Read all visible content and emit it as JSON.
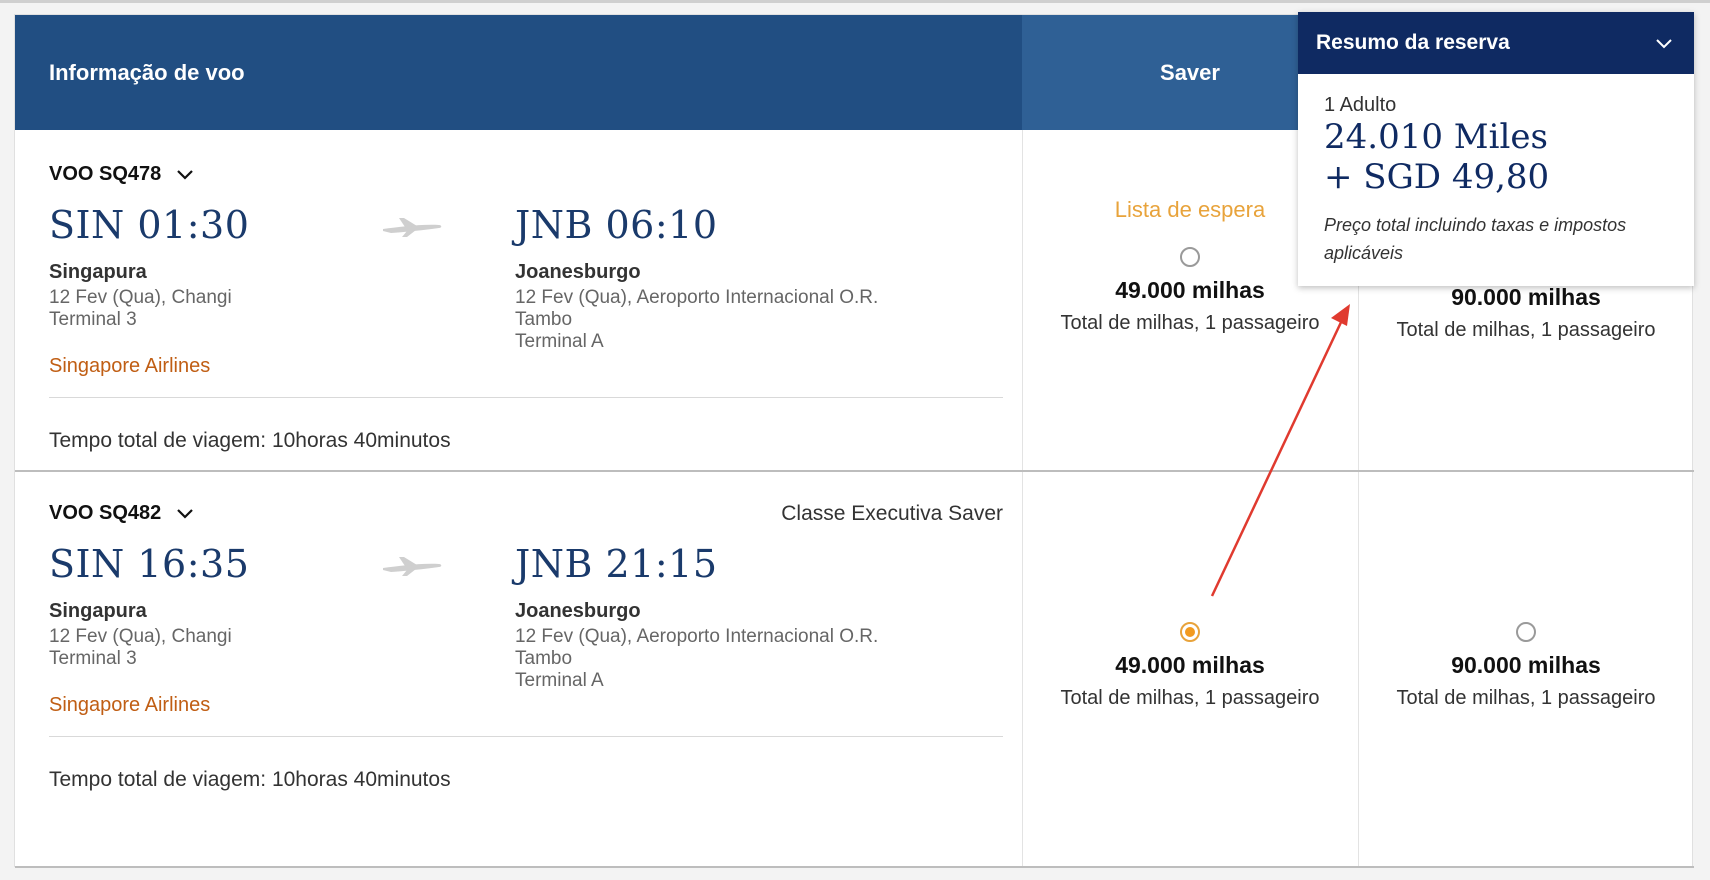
{
  "header": {
    "info_label": "Informação de voo",
    "saver_label": "Saver"
  },
  "summary": {
    "title": "Resumo da reserva",
    "passengers": "1 Adulto",
    "miles": "24.010 Miles",
    "cash": "+ SGD 49,80",
    "note": "Preço total incluindo taxas e impostos aplicáveis"
  },
  "flights": [
    {
      "flight_no": "VOO SQ478",
      "cabin": "",
      "dep_time": "SIN 01:30",
      "dep_city": "Singapura",
      "dep_detail1": "12 Fev (Qua), Changi",
      "dep_detail2": "Terminal 3",
      "arr_time": "JNB 06:10",
      "arr_city": "Joanesburgo",
      "arr_detail1": "12 Fev (Qua), Aeroporto Internacional O.R.",
      "arr_detail2": "Tambo",
      "arr_detail3": "Terminal A",
      "airline": "Singapore Airlines",
      "total_time": "Tempo total de viagem: 10horas 40minutos",
      "fares": [
        {
          "status": "Lista de espera",
          "miles": "49.000 milhas",
          "sub": "Total de milhas, 1 passageiro",
          "selected": false
        },
        {
          "status": "",
          "miles": "90.000 milhas",
          "sub": "Total de milhas, 1 passageiro",
          "selected": false
        }
      ]
    },
    {
      "flight_no": "VOO SQ482",
      "cabin": "Classe Executiva Saver",
      "dep_time": "SIN 16:35",
      "dep_city": "Singapura",
      "dep_detail1": "12 Fev (Qua), Changi",
      "dep_detail2": "Terminal 3",
      "arr_time": "JNB 21:15",
      "arr_city": "Joanesburgo",
      "arr_detail1": "12 Fev (Qua), Aeroporto Internacional O.R.",
      "arr_detail2": "Tambo",
      "arr_detail3": "Terminal A",
      "airline": "Singapore Airlines",
      "total_time": "Tempo total de viagem: 10horas 40minutos",
      "fares": [
        {
          "status": "",
          "miles": "49.000 milhas",
          "sub": "Total de milhas, 1 passageiro",
          "selected": true
        },
        {
          "status": "",
          "miles": "90.000 milhas",
          "sub": "Total de milhas, 1 passageiro",
          "selected": false
        }
      ]
    }
  ],
  "colors": {
    "header_dark": "#214e82",
    "header_saver": "#2f6095",
    "summary_header": "#0f2a62",
    "airline": "#c05e14",
    "waitlist": "#e8a33b",
    "annotation_arrow": "#e03a2f"
  }
}
